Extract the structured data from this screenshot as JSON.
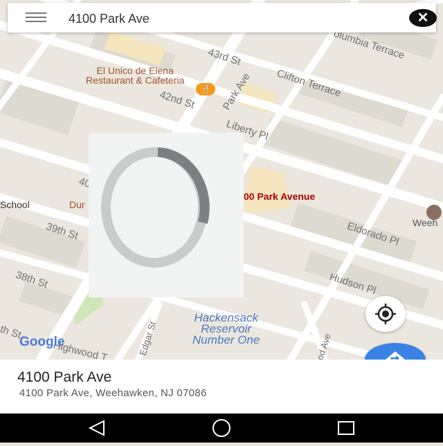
{
  "search": {
    "value": "4100 Park Ave",
    "clear_label": "✕"
  },
  "map": {
    "streets": {
      "s43rd": "43rd St",
      "columbia": "olumbia Terrace",
      "parkave": "Park Ave",
      "clifton": "Clifton Terrace",
      "s42nd": "42nd St",
      "liberty": "Liberty Pl",
      "s40": "40",
      "s39th": "39th St",
      "s38th": "38th St",
      "eldorado": "Eldorado Pl",
      "hudson": "Hudson Pl",
      "edgar": "Edgar St",
      "highwood": "Highwood T",
      "parkave2": "od Ave",
      "st": "th St"
    },
    "restaurant": {
      "line1": "El Unico de Elena",
      "line2": "Restaurant & Cafeteria"
    },
    "school": "School",
    "dur": "Dur",
    "place_label": "00 Park Avenue",
    "weeh": "Weeh",
    "reservoir": {
      "line1": "Hackensack",
      "line2": "Reservoir",
      "line3": "Number One"
    },
    "logo": "Google",
    "colors": {
      "road": "#ffffff",
      "land": "#ebe7de",
      "building": "#dcd8cf",
      "poi": "#f9e7b8",
      "park_text": "#4a78c2",
      "place_text": "#b00000"
    }
  },
  "place": {
    "title": "4100 Park Ave",
    "address": "4100 Park Ave, Weehawken, NJ 07086"
  },
  "icons": {
    "menu": "menu-icon",
    "locate": "my-location-icon",
    "directions": "directions-icon",
    "back": "back-icon",
    "home": "home-icon",
    "recents": "recents-icon"
  }
}
